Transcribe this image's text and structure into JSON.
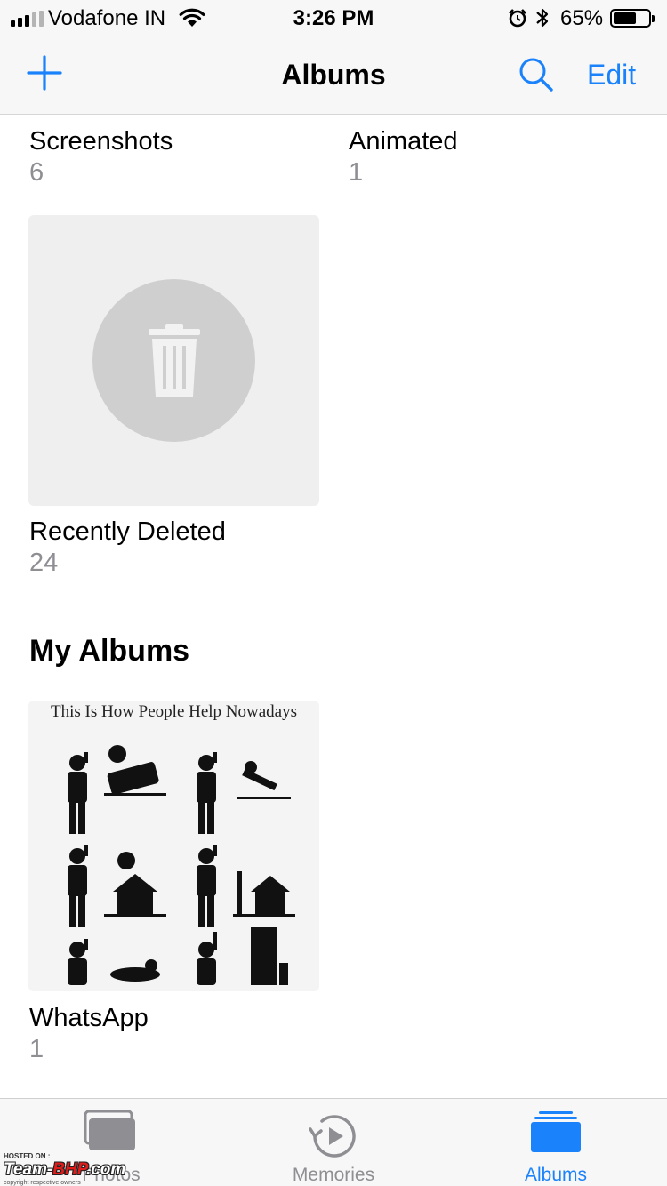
{
  "status_bar": {
    "carrier": "Vodafone IN",
    "time": "3:26 PM",
    "battery_percent": "65%",
    "battery_level": 0.65,
    "signal_bars_on": 3,
    "signal_bars_total": 5
  },
  "nav": {
    "title": "Albums",
    "edit_label": "Edit",
    "accent_color": "#1a82fb"
  },
  "albums": [
    {
      "name": "Screenshots",
      "count": "6"
    },
    {
      "name": "Animated",
      "count": "1"
    },
    {
      "name": "Recently Deleted",
      "count": "24"
    }
  ],
  "my_albums": {
    "title": "My Albums",
    "items": [
      {
        "name": "WhatsApp",
        "count": "1",
        "thumb_caption": "This Is How People Help Nowadays"
      }
    ]
  },
  "tab_bar": {
    "tabs": [
      {
        "label": "Photos",
        "icon": "photos-icon",
        "selected": false
      },
      {
        "label": "Memories",
        "icon": "memories-icon",
        "selected": false
      },
      {
        "label": "Albums",
        "icon": "albums-icon",
        "selected": true
      }
    ]
  },
  "watermark": {
    "hosted_on": "HOSTED ON :",
    "brand_prefix": "Team-",
    "brand_highlight": "BHP",
    "brand_suffix": ".com",
    "copyright": "copyright respective owners"
  }
}
